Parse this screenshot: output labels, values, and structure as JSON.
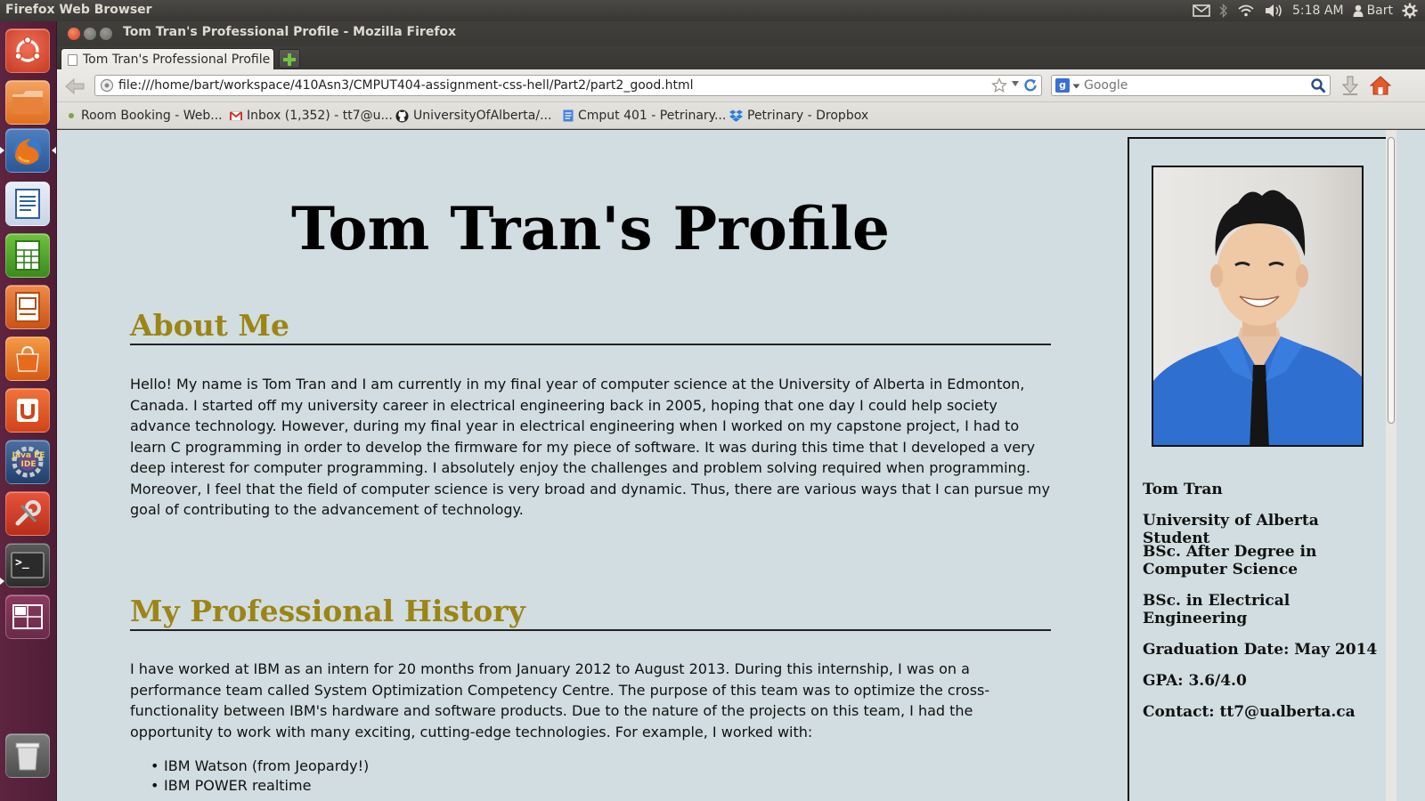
{
  "top_panel": {
    "app_title": "Firefox Web Browser",
    "time": "5:18 AM",
    "user": "Bart",
    "indicators": [
      "mail-icon",
      "bluetooth-icon",
      "wifi-icon",
      "volume-icon",
      "user-icon",
      "gear-icon"
    ]
  },
  "launcher": {
    "items": [
      "ubuntu-dash",
      "files",
      "firefox",
      "libreoffice-writer",
      "libreoffice-calc",
      "libreoffice-impress",
      "software-center",
      "ubuntu-one",
      "java-ee-ide",
      "system-settings",
      "terminal",
      "workspace-switcher",
      "trash"
    ],
    "java_icon_text": "Java EE IDE",
    "terminal_prompt": ">_"
  },
  "window": {
    "title": "Tom Tran's Professional Profile - Mozilla Firefox"
  },
  "tabs": [
    {
      "label": "Tom Tran's Professional Profile"
    }
  ],
  "navbar": {
    "url": "file:///home/bart/workspace/410Asn3/CMPUT404-assignment-css-hell/Part2/part2_good.html",
    "search_placeholder": "Google",
    "search_engine_letter": "g"
  },
  "bookmarks": [
    {
      "label": "Room Booking - Web...",
      "icon": "globe-dot-icon"
    },
    {
      "label": "Inbox (1,352) - tt7@u...",
      "icon": "gmail-icon"
    },
    {
      "label": "UniversityOfAlberta/...",
      "icon": "github-icon"
    },
    {
      "label": "Cmput 401 - Petrinary...",
      "icon": "google-docs-icon"
    },
    {
      "label": "Petrinary - Dropbox",
      "icon": "dropbox-icon"
    }
  ],
  "page": {
    "title": "Tom Tran's Profile",
    "sections": [
      {
        "heading": "About Me",
        "body": "Hello! My name is Tom Tran and I am currently in my final year of computer science at the University of Alberta in Edmonton, Canada. I started off my university career in electrical engineering back in 2005, hoping that one day I could help society advance technology. However, during my final year in electrical engineering when I worked on my capstone project, I had to learn C programming in order to develop the firmware for my piece of software. It was during this time that I developed a very deep interest for computer programming. I absolutely enjoy the challenges and problem solving required when programming. Moreover, I feel that the field of computer science is very broad and dynamic. Thus, there are various ways that I can pursue my goal of contributing to the advancement of technology."
      },
      {
        "heading": "My Professional History",
        "body": "I have worked at IBM as an intern for 20 months from January 2012 to August 2013. During this internship, I was on a performance team called System Optimization Competency Centre. The purpose of this team was to optimize the cross-functionality between IBM's hardware and software products. Due to the nature of the projects on this team, I had the opportunity to work with many exciting, cutting-edge technologies. For example, I worked with:",
        "list": [
          "IBM Watson (from Jeopardy!)",
          "IBM POWER realtime"
        ]
      }
    ],
    "sidebar": {
      "name": "Tom Tran",
      "school": "University of Alberta Student",
      "degree1": "BSc. After Degree in Computer Science",
      "degree2": "BSc. in Electrical Engineering",
      "graduation": "Graduation Date: May 2014",
      "gpa": "GPA: 3.6/4.0",
      "contact": "Contact: tt7@ualberta.ca"
    }
  },
  "colors": {
    "page_bg": "#d1dde0",
    "heading_gold": "#9c8516",
    "launcher_bg": "#5e2440",
    "shirt_blue": "#2f6fd0"
  }
}
